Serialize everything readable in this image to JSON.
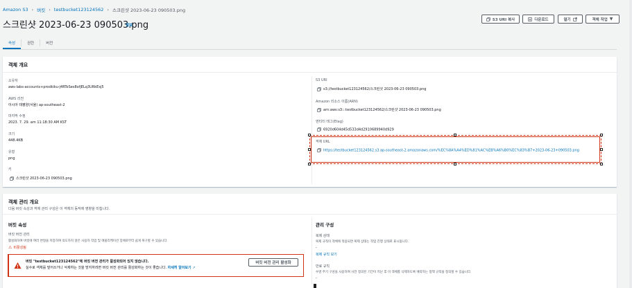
{
  "breadcrumbs": [
    "Amazon S3",
    "버킷",
    "testbucket123124562",
    "스크린샷 2023-06-23 090503.png"
  ],
  "page_title": "스크린샷 2023-06-23 090503.png",
  "info_label": "정보",
  "actions": {
    "copy_uri": "S3 URI 복사",
    "download": "다운로드",
    "open": "열기",
    "object_actions": "객체 작업"
  },
  "tabs": [
    "속성",
    "권한",
    "버전"
  ],
  "overview": {
    "title": "객체 개요",
    "left": [
      {
        "label": "소유자",
        "value": "aws-labs-accounts+prodkiku-j4RToSes8ofjELq3URkEsj5"
      },
      {
        "label": "AWS 리전",
        "value": "아시아 태평양(서울) ap-southeast-2"
      },
      {
        "label": "마지막 수정",
        "value": "2023. 7. 29. am 11:18:30 AM KST"
      },
      {
        "label": "크기",
        "value": "448.4KB"
      },
      {
        "label": "유형",
        "value": "png"
      },
      {
        "label": "키",
        "value": "스크린샷 2023-06-23 090503.png"
      }
    ],
    "right": [
      {
        "label": "S3 URI",
        "value": "s3://testbucket123124562/스크린샷 2023-06-23 090503.png"
      },
      {
        "label": "Amazon 리소스 이름(ARN)",
        "value": "arn:aws:s3:::testbucket123124562/스크린샷 2023-06-23 090503.png"
      },
      {
        "label": "엔티티 태그(Etag)",
        "value": "6920d604d45d533d4d2910689940d929"
      },
      {
        "label": "객체 URL",
        "value": "https://testbucket123124562.s3.ap-southeast-2.amazonaws.com/%EC%8A%A4%ED%81%AC%EB%A6%B0%EC%83%B7+2023-06-23+090503.png"
      }
    ]
  },
  "management": {
    "title": "객체 관리 개요",
    "subtitle": "다음 버킷 속성과 객체 관리 구성은 이 객체의 동작에 영향을 미칩니다.",
    "bucket_props_title": "버킷 속성",
    "versioning_label": "버킷 버전 관리",
    "versioning_desc": "활성화하여 버킷에 여러 변형을 저장하여 의도하지 않은 사용자 작업 및 애플리케이션 장애로부터 쉽게 복구할 수 있습니다.",
    "versioning_status": "비활성됨",
    "warning_text": "버킷 \"testbucket123124562\"에 버킷 버전 관리가 활성화되어 있지 않습니다.",
    "warning_sub": "실수로 객체를 덮어쓰거나 삭제하는 것을 방지하려면 버킷 버전 관리를 활성화하는 것이 좋습니다.",
    "warning_link": "자세히 알아보기",
    "warning_button": "버킷 버전 관리 활성화",
    "mgmt_config_title": "관리 구성",
    "replication_label": "복제 상태",
    "replication_desc": "복제 규칙이 객체에 적용되면 복제 상태는 작업 진행 상태로 표시됩니다.",
    "replication_value": "-",
    "replication_link": "복제 규칙 보기",
    "expiry_label": "만료 규칙",
    "expiry_desc": "수명 주기 구성을 사용하여 사전 정의된 기간이 지난 후 이 객체를 삭제하도록 예약하는 정책 규칙을 정의할 수 있습니다.",
    "expiry_value": "-"
  }
}
